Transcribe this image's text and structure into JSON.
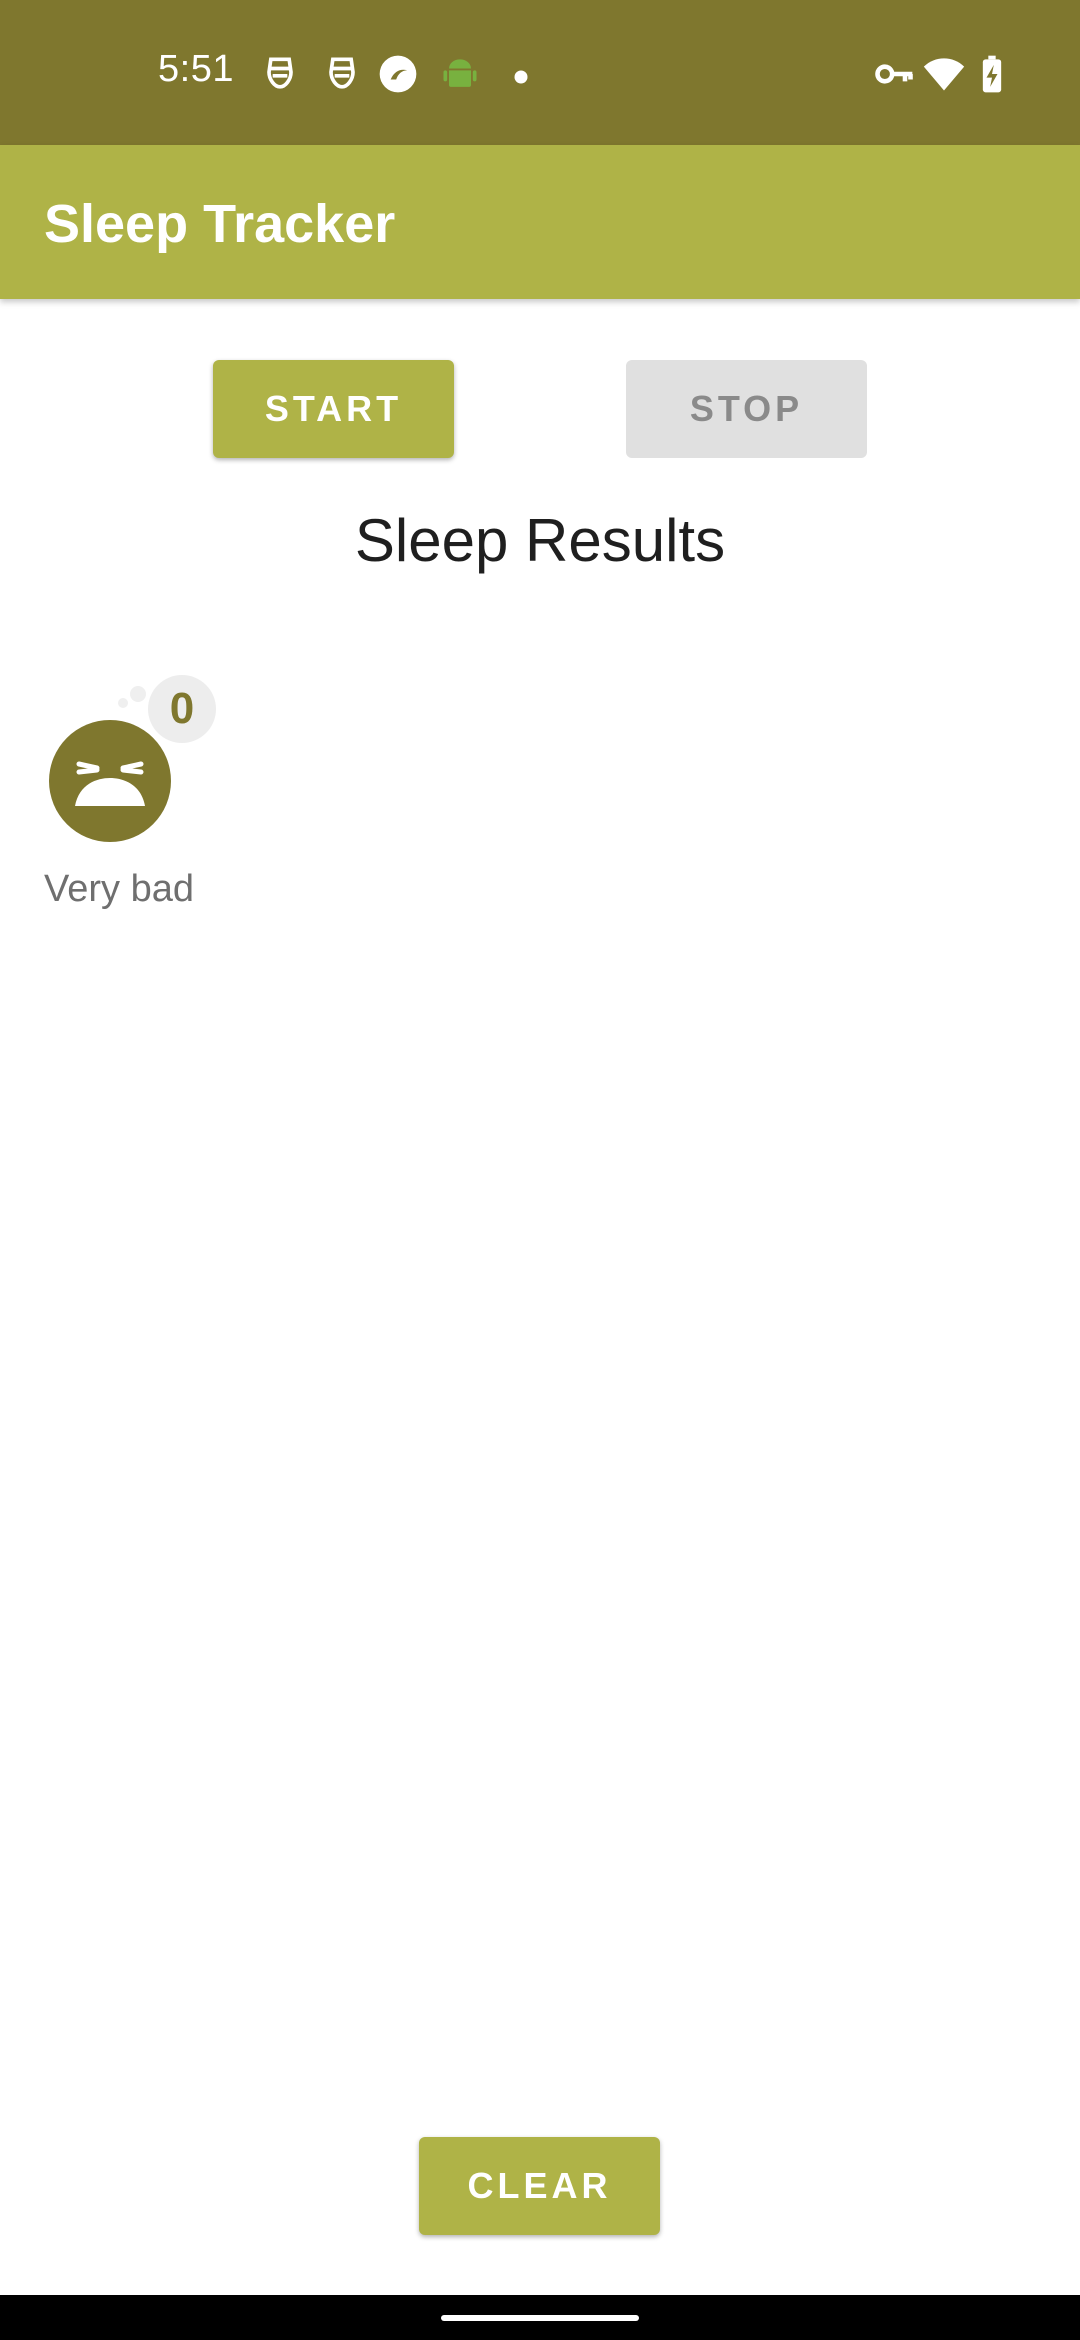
{
  "status_bar": {
    "time": "5:51",
    "background_color": "#7f772e",
    "left_icons": [
      "face-mask-icon",
      "face-mask-icon",
      "app-circle-icon",
      "android-icon",
      "dot-icon"
    ],
    "right_icons": [
      "vpn-key-icon",
      "wifi-icon",
      "battery-charging-icon"
    ]
  },
  "app_bar": {
    "title": "Sleep Tracker",
    "background_color": "#afb347"
  },
  "controls": {
    "start_label": "START",
    "stop_label": "STOP",
    "clear_label": "CLEAR"
  },
  "main": {
    "section_title": "Sleep Results",
    "results": [
      {
        "count": "0",
        "quality_label": "Very bad",
        "icon": "very-bad-sleep-face-icon",
        "icon_color": "#7f772e"
      }
    ]
  }
}
